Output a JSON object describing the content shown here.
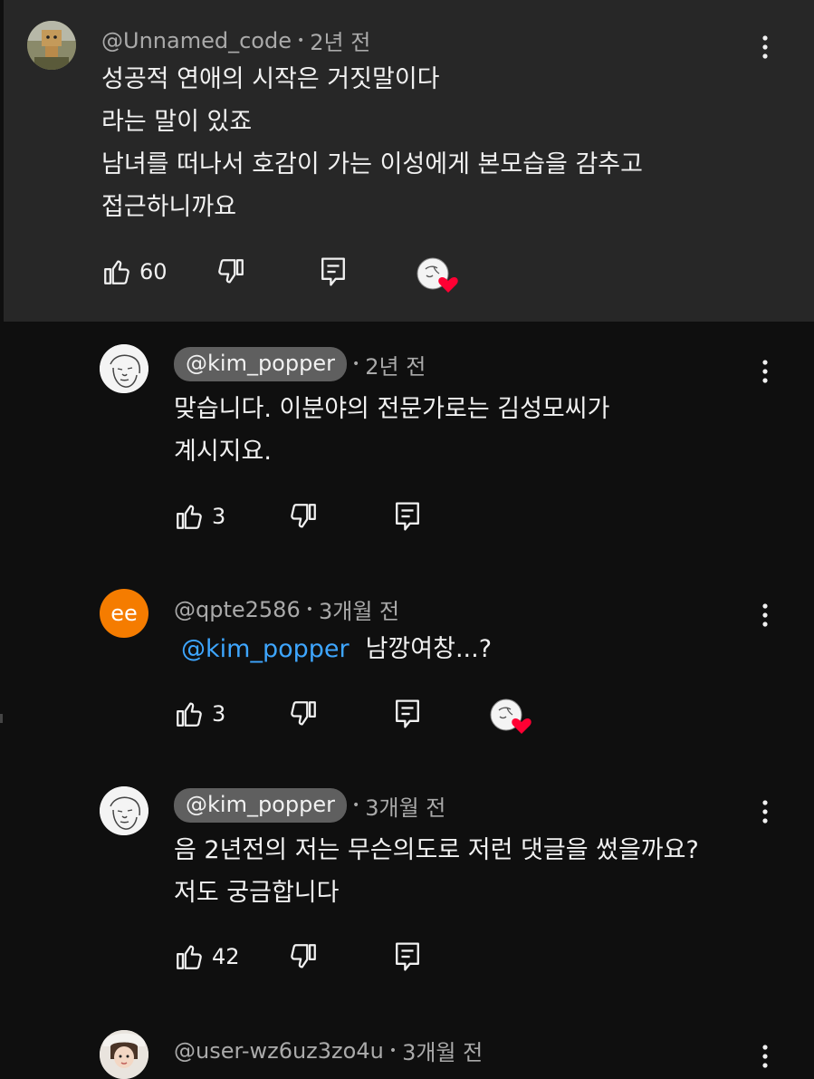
{
  "comments": [
    {
      "handle": "@Unnamed_code",
      "time": "2년 전",
      "lines": "성공적 연애의 시작은 거짓말이다\n라는 말이 있죠\n남녀를 떠나서 호감이 가는 이성에게 본모습을 감추고\n접근하니까요",
      "likes": "60",
      "hearted": true,
      "avatar_icon": "cardboard-robot-figure-avatar"
    },
    {
      "handle": "@kim_popper",
      "time": "2년 전",
      "creator": true,
      "lines": "맞습니다. 이분야의 전문가로는 김성모씨가\n계시지요.",
      "likes": "3",
      "hearted": false,
      "avatar_icon": "sketched-face-avatar"
    },
    {
      "handle": "@qpte2586",
      "time": "3개월 전",
      "avatar_text": "ee",
      "avatar_color": "#f57c00",
      "mention": "@kim_popper",
      "text": "남깡여창...?",
      "likes": "3",
      "hearted": true
    },
    {
      "handle": "@kim_popper",
      "time": "3개월 전",
      "creator": true,
      "lines": "음 2년전의 저는 무슨의도로 저런 댓글을 썼을까요?\n저도 궁금합니다",
      "likes": "42",
      "hearted": false,
      "avatar_icon": "sketched-face-avatar"
    },
    {
      "handle": "@user-wz6uz3zo4u",
      "time": "3개월 전",
      "avatar_icon": "user-photo-avatar"
    }
  ],
  "colors": {
    "background": "#0f0f0f",
    "highlight_background": "#272727",
    "mention": "#3ea6ff",
    "heart": "#ff0033"
  },
  "separator": "•"
}
